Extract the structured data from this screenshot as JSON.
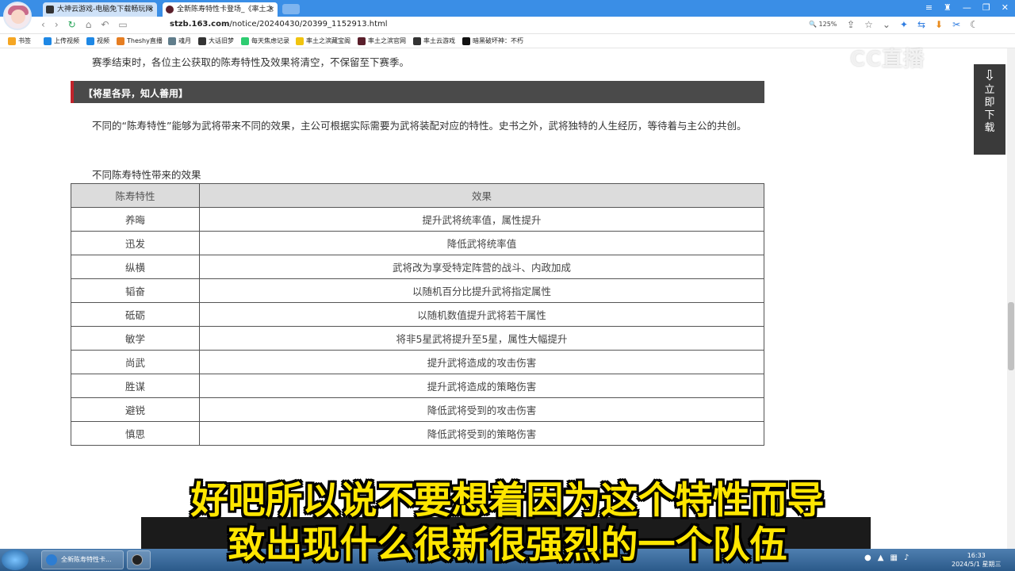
{
  "browser": {
    "tabs": [
      {
        "label": "大神云游戏-电脑免下载畅玩网",
        "close": "×"
      },
      {
        "label": "全新陈寿特性卡登场_《率土之",
        "close": "×"
      }
    ],
    "window_controls": [
      "≡",
      "♜",
      "—",
      "❐",
      "✕"
    ],
    "url_host": "stzb.163.com",
    "url_path": "/notice/20240430/20399_1152913.html",
    "zoom": "125%",
    "bookmarks": [
      {
        "label": "书签",
        "color": "#f5a623"
      },
      {
        "label": "上传视频",
        "color": "#1e88e5"
      },
      {
        "label": "视频",
        "color": "#1e88e5"
      },
      {
        "label": "Theshy直播",
        "color": "#e67e22"
      },
      {
        "label": "魂月",
        "color": "#607d8b"
      },
      {
        "label": "大话旧梦",
        "color": "#333333"
      },
      {
        "label": "每天焦虑记录",
        "color": "#2ecc71"
      },
      {
        "label": "率土之滨藏宝阁",
        "color": "#f1c40f"
      },
      {
        "label": "率土之滨官网",
        "color": "#5a1f2b"
      },
      {
        "label": "率土云游戏",
        "color": "#333333"
      },
      {
        "label": "暗黑破坏神：不朽",
        "color": "#111111"
      }
    ]
  },
  "article": {
    "intro": "赛季结束时，各位主公获取的陈寿特性及效果将清空，不保留至下赛季。",
    "section_title": "【将星各异，知人善用】",
    "body": "不同的“陈寿特性”能够为武将带来不同的效果，主公可根据实际需要为武将装配对应的特性。史书之外，武将独特的人生经历，等待着与主公的共创。",
    "table_caption": "不同陈寿特性带来的效果",
    "table": {
      "headers": [
        "陈寿特性",
        "效果"
      ],
      "rows": [
        [
          "养晦",
          "提升武将统率值，属性提升"
        ],
        [
          "迅发",
          "降低武将统率值"
        ],
        [
          "纵横",
          "武将改为享受特定阵营的战斗、内政加成"
        ],
        [
          "韬奋",
          "以随机百分比提升武将指定属性"
        ],
        [
          "砥砺",
          "以随机数值提升武将若干属性"
        ],
        [
          "敏学",
          "将非5星武将提升至5星，属性大幅提升"
        ],
        [
          "尚武",
          "提升武将造成的攻击伤害"
        ],
        [
          "胜谋",
          "提升武将造成的策略伤害"
        ],
        [
          "避锐",
          "降低武将受到的攻击伤害"
        ],
        [
          "慎思",
          "降低武将受到的策略伤害"
        ]
      ]
    }
  },
  "widgets": {
    "watermark": "CC直播",
    "download": [
      "立",
      "即",
      "下",
      "载"
    ]
  },
  "subtitles": {
    "line1": "好吧所以说不要想着因为这个特性而导",
    "line2": "致出现什么很新很强烈的一个队伍"
  },
  "taskbar": {
    "task1_label": "全新陈寿特性卡...",
    "time": "16:33",
    "date": "2024/5/1 星期三"
  }
}
